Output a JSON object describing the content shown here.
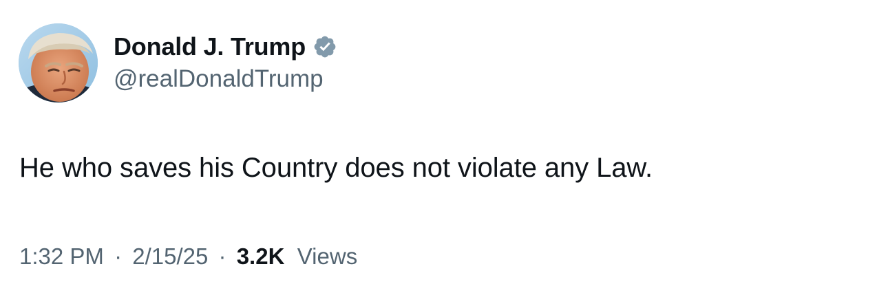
{
  "author": {
    "display_name": "Donald J. Trump",
    "handle": "@realDonaldTrump",
    "verified": true,
    "badge_color": "#829aab",
    "avatar_icon": "profile-photo"
  },
  "post": {
    "text": "He who saves his Country does not violate any Law."
  },
  "meta": {
    "time": "1:32 PM",
    "separator": "·",
    "date": "2/15/25",
    "views_count": "3.2K",
    "views_label": "Views"
  },
  "colors": {
    "primary_text": "#0f1419",
    "secondary_text": "#536471",
    "background": "#ffffff"
  }
}
